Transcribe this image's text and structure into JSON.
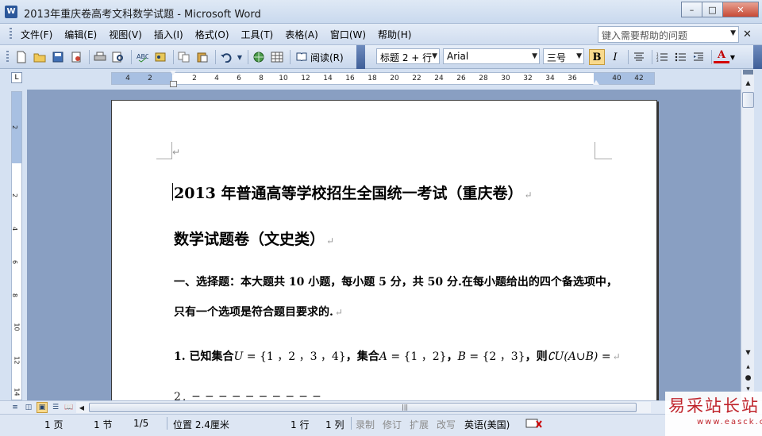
{
  "window": {
    "app_icon": "W",
    "title": "2013年重庆卷高考文科数学试题 - Microsoft Word",
    "min_label": "–",
    "max_label": "□",
    "close_label": "✕"
  },
  "menubar": {
    "items": [
      {
        "label": "文件(F)"
      },
      {
        "label": "编辑(E)"
      },
      {
        "label": "视图(V)"
      },
      {
        "label": "插入(I)"
      },
      {
        "label": "格式(O)"
      },
      {
        "label": "工具(T)"
      },
      {
        "label": "表格(A)"
      },
      {
        "label": "窗口(W)"
      },
      {
        "label": "帮助(H)"
      }
    ],
    "help_placeholder": "键入需要帮助的问题",
    "close_label": "✕"
  },
  "toolbar": {
    "icons": [
      {
        "name": "new-document-icon",
        "glyph": "🗋"
      },
      {
        "name": "open-folder-icon",
        "glyph": "📂"
      },
      {
        "name": "save-icon",
        "glyph": "💾"
      },
      {
        "name": "permission-icon",
        "glyph": "🔒"
      },
      {
        "name": "print-icon",
        "glyph": "🖶"
      },
      {
        "name": "print-preview-icon",
        "glyph": "🔍"
      },
      {
        "name": "spelling-icon",
        "glyph": "✓"
      },
      {
        "name": "research-icon",
        "glyph": "📖"
      },
      {
        "name": "copy-icon",
        "glyph": "⧉"
      },
      {
        "name": "paste-icon",
        "glyph": "📋"
      },
      {
        "name": "undo-icon",
        "glyph": "↶"
      },
      {
        "name": "hyperlink-icon",
        "glyph": "🌐"
      },
      {
        "name": "table-icon",
        "glyph": "▦"
      }
    ],
    "read_label": "阅读(R)",
    "style_value": "标题 2 + 行",
    "font_value": "Arial",
    "size_value": "三号",
    "bold_label": "B",
    "italic_label": "I",
    "font_color_label": "A"
  },
  "ruler": {
    "tab_selector": "L",
    "ticks": [
      "4",
      "2",
      "2",
      "4",
      "6",
      "8",
      "10",
      "12",
      "14",
      "16",
      "18",
      "20",
      "22",
      "24",
      "26",
      "28",
      "30",
      "32",
      "34",
      "36",
      "40",
      "42"
    ],
    "vticks": [
      "2",
      "2",
      "4",
      "6",
      "8",
      "10",
      "12",
      "14"
    ]
  },
  "document": {
    "heading1": "2013 年普通高等学校招生全国统一考试（重庆卷）",
    "heading2": "数学试题卷（文史类）",
    "para1": "一、选择题：本大题共 10 小题，每小题 5 分，共 50 分.在每小题给出的四个备选项中，",
    "para2": "只有一个选项是符合题目要求的.",
    "q1_prefix": "1. 已知集合",
    "q1_U": "U",
    "q1_Uset": " = {1 ，2 ，3 ，4}",
    "q1_mid": "，集合",
    "q1_A": "A",
    "q1_Aset": " = {1 ，2}",
    "q1_comma": "，",
    "q1_B": "B",
    "q1_Bset": " = {2 ，3}",
    "q1_then": "，则",
    "q1_expr": "∁U(A∪B) =",
    "para_mark": "↵",
    "cut_line": "2.  ─  ─  ─  ─  ─  ─  ─  ─  ─  ─"
  },
  "statusbar": {
    "page": "1 页",
    "section": "1 节",
    "page_of": "1/5",
    "position": "位置 2.4厘米",
    "line": "1 行",
    "column": "1 列",
    "rec": "录制",
    "trk": "修订",
    "ext": "扩展",
    "ovr": "改写",
    "language": "英语(美国)"
  },
  "watermark": {
    "big": "易采站长站",
    "small": "www.easck.com"
  },
  "colors": {
    "accent": "#2b579a",
    "bold_highlight": "#f8d98c",
    "font_color": "#d40000",
    "watermark": "#c0262d"
  }
}
